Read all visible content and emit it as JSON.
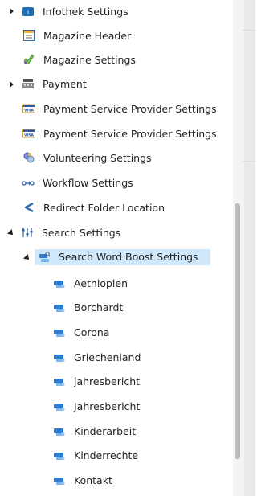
{
  "tree": {
    "items": [
      {
        "label": "Infothek Settings",
        "icon": "infothek-icon"
      },
      {
        "label": "Magazine Header",
        "icon": "magazine-header-icon"
      },
      {
        "label": "Magazine Settings",
        "icon": "magazine-settings-icon"
      },
      {
        "label": "Payment",
        "icon": "payment-icon"
      },
      {
        "label": "Payment Service Provider Settings",
        "icon": "visa-card-icon"
      },
      {
        "label": "Payment Service Provider Settings",
        "icon": "visa-card-icon"
      },
      {
        "label": "Volunteering Settings",
        "icon": "volunteering-icon"
      },
      {
        "label": "Workflow Settings",
        "icon": "workflow-icon"
      },
      {
        "label": "Redirect Folder Location",
        "icon": "redirect-icon"
      },
      {
        "label": "Search Settings",
        "icon": "search-settings-icon"
      },
      {
        "label": "Search Word Boost Settings",
        "icon": "search-word-boost-icon"
      },
      {
        "label": "Aethiopien",
        "icon": "search-word-icon"
      },
      {
        "label": "Borchardt",
        "icon": "search-word-icon"
      },
      {
        "label": "Corona",
        "icon": "search-word-icon"
      },
      {
        "label": "Griechenland",
        "icon": "search-word-icon"
      },
      {
        "label": "jahresbericht",
        "icon": "search-word-icon"
      },
      {
        "label": "Jahresbericht",
        "icon": "search-word-icon"
      },
      {
        "label": "Kinderarbeit",
        "icon": "search-word-icon"
      },
      {
        "label": "Kinderrechte",
        "icon": "search-word-icon"
      },
      {
        "label": "Kontakt",
        "icon": "search-word-icon"
      }
    ]
  },
  "colors": {
    "selected_bg": "#cfe8fb",
    "scrollbar": "#bdbdbd"
  }
}
